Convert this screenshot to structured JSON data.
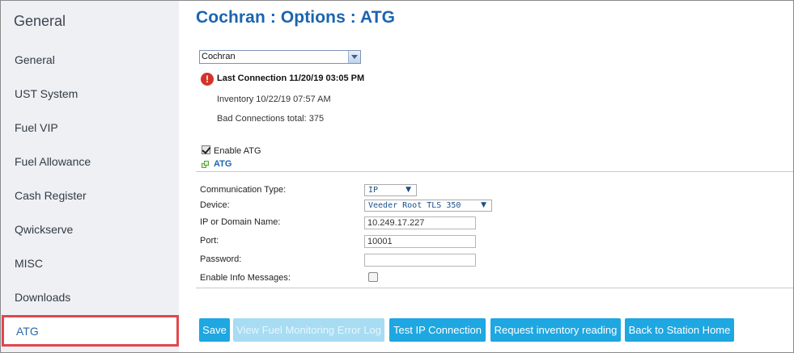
{
  "sidebar": {
    "title": "General",
    "items": [
      {
        "label": "General"
      },
      {
        "label": "UST System"
      },
      {
        "label": "Fuel VIP"
      },
      {
        "label": "Fuel Allowance"
      },
      {
        "label": "Cash Register"
      },
      {
        "label": "Qwickserve"
      },
      {
        "label": "MISC"
      },
      {
        "label": "Downloads"
      },
      {
        "label": "ATG"
      }
    ],
    "active_item": "ATG"
  },
  "header": {
    "title": "Cochran : Options : ATG"
  },
  "station_select": {
    "value": "Cochran"
  },
  "status": {
    "last_connection": "Last Connection 11/20/19 03:05 PM",
    "inventory": "Inventory 10/22/19 07:57 AM",
    "bad_connections": "Bad Connections total: 375"
  },
  "enable_atg": {
    "label": "Enable ATG",
    "checked": true
  },
  "section": {
    "title": "ATG"
  },
  "form": {
    "communication_type": {
      "label": "Communication Type:",
      "value": "IP"
    },
    "device": {
      "label": "Device:",
      "value": "Veeder Root TLS 350"
    },
    "ip": {
      "label": "IP or Domain Name:",
      "value": "10.249.17.227"
    },
    "port": {
      "label": "Port:",
      "value": "10001"
    },
    "password": {
      "label": "Password:",
      "value": ""
    },
    "info_messages": {
      "label": "Enable Info Messages:",
      "checked": false
    }
  },
  "buttons": {
    "save": "Save",
    "view_error_log": "View Fuel Monitoring Error Log",
    "test_ip": "Test IP Connection",
    "request_inventory": "Request inventory reading",
    "back_home": "Back to Station Home"
  },
  "colors": {
    "accent": "#1ea7e1",
    "title_blue": "#1b64b0",
    "active_border": "#e0474c",
    "error_icon": "#d3332b"
  }
}
